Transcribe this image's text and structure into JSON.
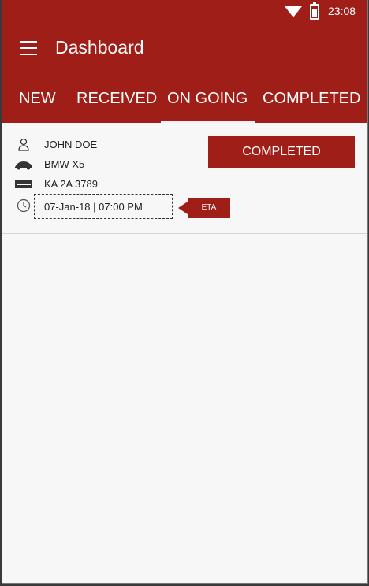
{
  "status_bar": {
    "time": "23:08",
    "icons": [
      "wifi-icon",
      "battery-icon"
    ]
  },
  "app_bar": {
    "title": "Dashboard",
    "menu_icon": "hamburger-menu-icon"
  },
  "tabs": [
    {
      "label": "NEW",
      "selected": false
    },
    {
      "label": "RECEIVED",
      "selected": false
    },
    {
      "label": "ON GOING",
      "selected": true
    },
    {
      "label": "COMPLETED",
      "selected": false
    }
  ],
  "booking": {
    "customer_name": "JOHN DOE",
    "car_model": "BMW X5",
    "plate_number": "KA 2A 3789",
    "eta": "07-Jan-18 | 07:00 PM",
    "eta_tag": "ETA",
    "status_button": "COMPLETED",
    "icons": [
      "person-icon",
      "car-icon",
      "license-plate-icon",
      "clock-icon"
    ]
  },
  "colors": {
    "brand": "#a01e18",
    "background": "#f7f7f7",
    "text": "#222222"
  }
}
